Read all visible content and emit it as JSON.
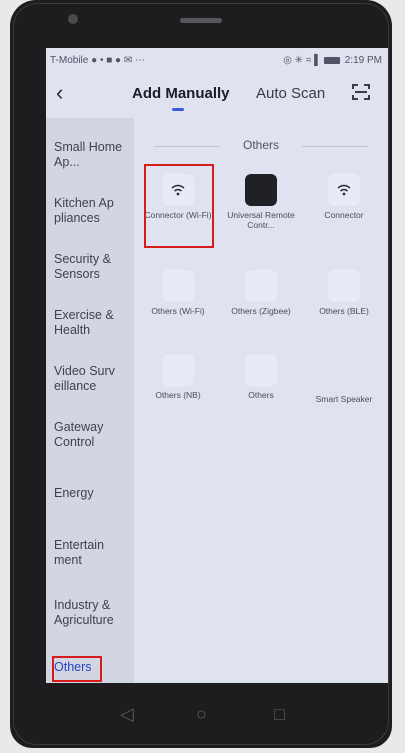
{
  "status": {
    "carrier": "T-Mobile",
    "left_icons": "● • ■ ● ✉ ⋯",
    "right_icons": "◎ ✳ ≈ ▌",
    "time": "2:19 PM"
  },
  "header": {
    "back_icon": "‹",
    "tab_manual": "Add Manually",
    "tab_scan": "Auto Scan"
  },
  "sidebar": {
    "items": [
      {
        "label": "Small Home Ap..."
      },
      {
        "label": "Kitchen Ap pliances"
      },
      {
        "label": "Security & Sensors"
      },
      {
        "label": "Exercise & Health"
      },
      {
        "label": "Video Surv eillance"
      },
      {
        "label": "Gateway Control"
      },
      {
        "label": "Energy"
      },
      {
        "label": "Entertain ment"
      },
      {
        "label": "Industry & Agriculture"
      },
      {
        "label": "Others"
      }
    ]
  },
  "content": {
    "section_title": "Others",
    "devices": [
      {
        "label": "Connector (Wi-Fi)",
        "icon": "wifi-icon"
      },
      {
        "label": "Universal Remote Contr...",
        "icon": "remote-icon"
      },
      {
        "label": "Connector",
        "icon": "wifi-icon"
      },
      {
        "label": "Others (Wi-Fi)",
        "icon": "device-icon"
      },
      {
        "label": "Others (Zigbee)",
        "icon": "device-icon"
      },
      {
        "label": "Others (BLE)",
        "icon": "device-icon"
      },
      {
        "label": "Others (NB)",
        "icon": "device-icon"
      },
      {
        "label": "Others",
        "icon": "device-icon"
      },
      {
        "label": "Smart Speaker",
        "icon": "speaker-icon"
      }
    ]
  },
  "navbar": {
    "back_glyph": "◁",
    "home_glyph": "○",
    "recent_glyph": "□"
  },
  "colors": {
    "accent": "#3b5bdb",
    "highlight_box": "#d81b1b",
    "sidebar_bg": "#d2d6e3",
    "content_bg": "#dfe2ef"
  }
}
